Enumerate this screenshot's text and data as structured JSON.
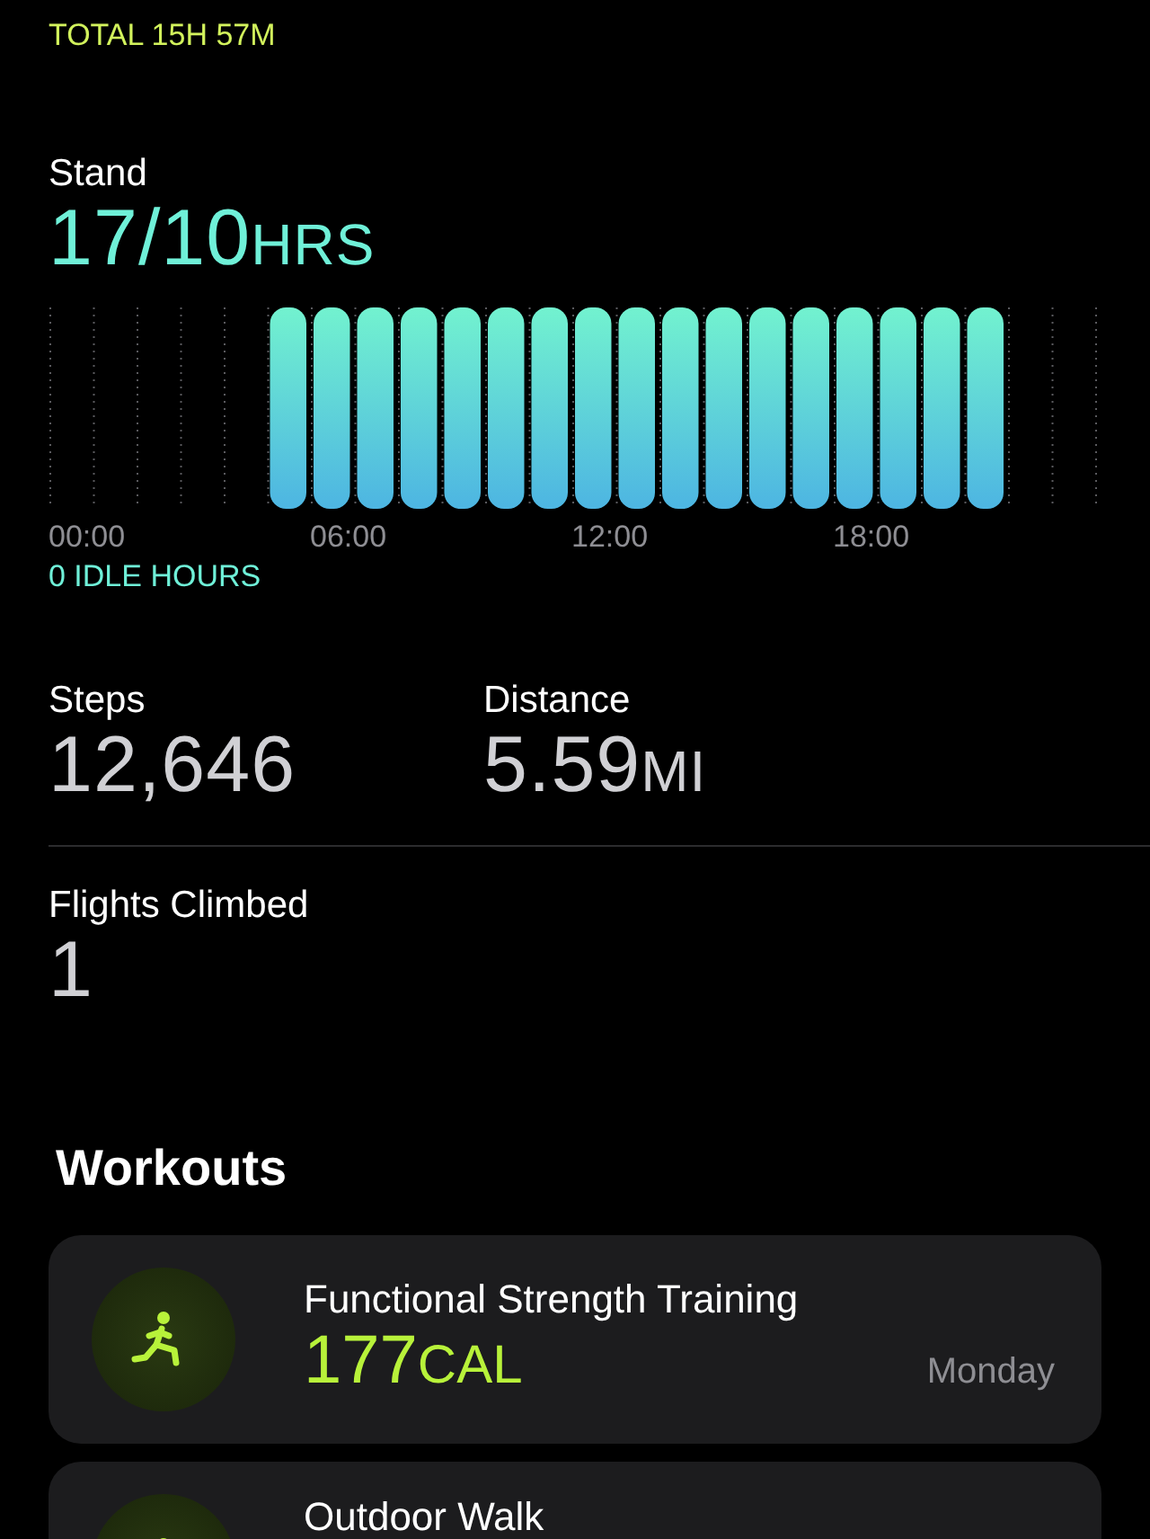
{
  "exercise": {
    "total": "TOTAL 15H 57M"
  },
  "stand": {
    "label": "Stand",
    "value": "17/10",
    "unit": "HRS",
    "axis": [
      "00:00",
      "06:00",
      "12:00",
      "18:00"
    ],
    "idle": "0 IDLE HOURS"
  },
  "stats": [
    {
      "label": "Steps",
      "value": "12,646"
    },
    {
      "label": "Distance",
      "value": "5.59",
      "unit": "MI"
    },
    {
      "label": "Flights Climbed",
      "value": "1"
    }
  ],
  "workouts": {
    "title": "Workouts",
    "items": [
      {
        "name": "Functional Strength Training",
        "value": "177",
        "unit": "CAL",
        "day": "Monday"
      },
      {
        "name": "Outdoor Walk"
      }
    ]
  }
}
